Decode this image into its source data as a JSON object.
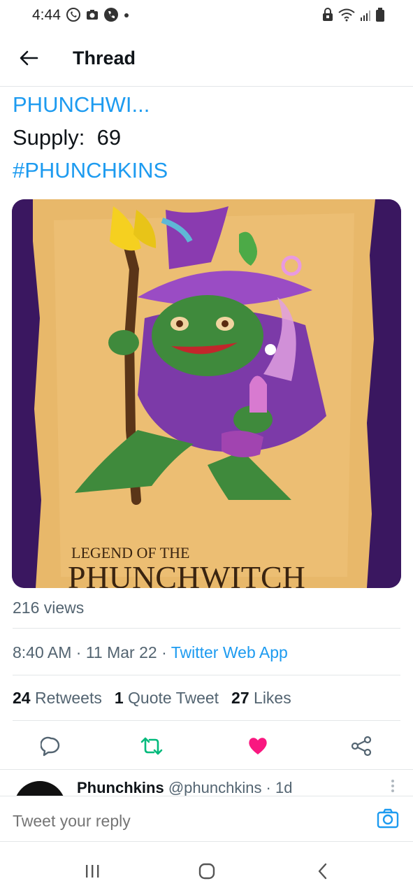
{
  "status_bar": {
    "time": "4:44",
    "left_icons": [
      "whatsapp-icon",
      "camera-icon",
      "phone-icon",
      "dot-icon"
    ],
    "right_icons": [
      "lock-icon",
      "wifi-icon",
      "signal-icon",
      "battery-icon"
    ]
  },
  "header": {
    "title": "Thread",
    "back_icon": "arrow-left-icon"
  },
  "tweet": {
    "text_line1": "PHUNCHWI...",
    "text_line2": "Supply:  69",
    "text_line3": "#PHUNCHKINS",
    "image_caption_line1": "LEGEND OF THE",
    "image_caption_line2": "PHUNCHWITCH",
    "views": "216 views",
    "time": "8:40 AM",
    "sep1": " · ",
    "date": "11 Mar 22",
    "sep2": " · ",
    "app": "Twitter Web App",
    "stats": {
      "retweets_count": "24",
      "retweets_label": "Retweets",
      "quote_count": "1",
      "quote_label": "Quote Tweet",
      "likes_count": "27",
      "likes_label": "Likes"
    }
  },
  "actions": {
    "reply_icon": "reply-icon",
    "retweet_icon": "retweet-icon",
    "like_icon": "heart-icon",
    "share_icon": "share-icon",
    "retweet_color": "#00ba7c",
    "like_color": "#f91880"
  },
  "reply_preview": {
    "name": "Phunchkins",
    "handle": "@phunchkins · 1d"
  },
  "compose": {
    "placeholder": "Tweet your reply"
  },
  "colors": {
    "accent": "#1d9bf0",
    "muted": "#536471"
  }
}
